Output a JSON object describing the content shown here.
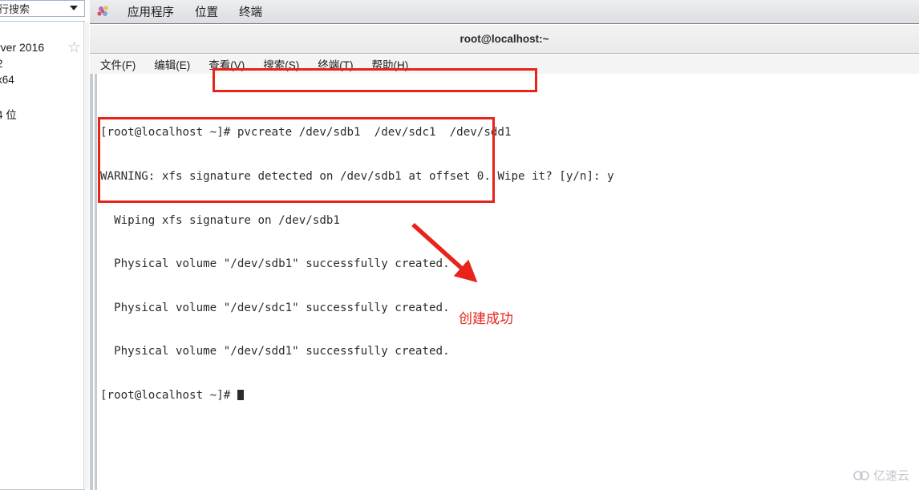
{
  "sidebar": {
    "search_text": "行搜索",
    "dropdown_icon": "chevron-down-icon",
    "star_icon": "star-outline-icon",
    "lines": [
      "rver 2016",
      " 2",
      " x64",
      "4 位"
    ]
  },
  "gnome_panel": {
    "app_icon": "gnome-applications-icon",
    "items": [
      "应用程序",
      "位置",
      "终端"
    ]
  },
  "terminal": {
    "title": "root@localhost:~",
    "menu": [
      "文件(F)",
      "编辑(E)",
      "查看(V)",
      "搜索(S)",
      "终端(T)",
      "帮助(H)"
    ],
    "lines": [
      "[root@localhost ~]# pvcreate /dev/sdb1  /dev/sdc1  /dev/sdd1",
      "WARNING: xfs signature detected on /dev/sdb1 at offset 0. Wipe it? [y/n]: y",
      "  Wiping xfs signature on /dev/sdb1",
      "  Physical volume \"/dev/sdb1\" successfully created.",
      "  Physical volume \"/dev/sdc1\" successfully created.",
      "  Physical volume \"/dev/sdd1\" successfully created."
    ],
    "prompt": "[root@localhost ~]# "
  },
  "annotations": {
    "color": "#e8231a",
    "arrow_icon": "red-arrow-icon",
    "label": "创建成功",
    "box_command_label": "highlight-command-box",
    "box_output_label": "highlight-output-box"
  },
  "watermark": {
    "icon": "cloud-logo-icon",
    "text": "亿速云"
  }
}
